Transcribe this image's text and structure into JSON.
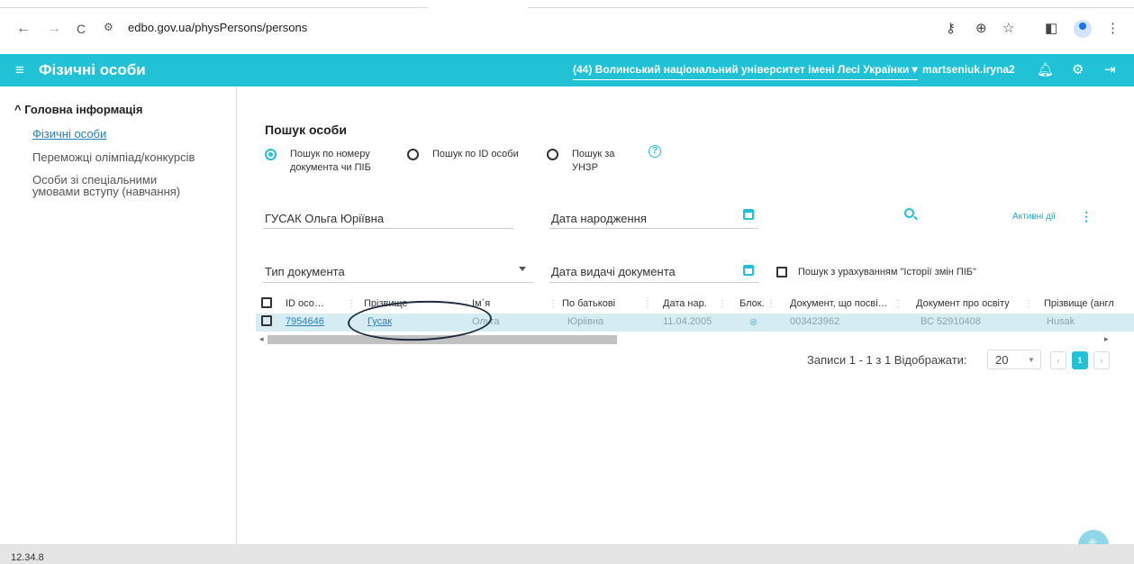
{
  "browser": {
    "back": "←",
    "forward": "→",
    "reload": "C",
    "site_icon": "⚙",
    "url": "edbo.gov.ua/physPersons/persons",
    "icons": [
      "key-icon",
      "zoom-icon",
      "star-icon",
      "sidepanel-icon",
      "profile-icon",
      "kebab-menu-icon"
    ]
  },
  "header": {
    "menu_glyph": "≡",
    "title": "Фізичні особи",
    "university": "(44) Волинський національний університет імені Лесі Українки",
    "username": "martseniuk.iryna2",
    "colors": {
      "accent": "#21c2d6"
    }
  },
  "sidebar": {
    "section": "^ Головна інформація",
    "items": [
      {
        "label": "Фізичні особи"
      },
      {
        "label": "Переможці олімпіад/конкурсів"
      },
      {
        "label": "Особи зі спеціальними"
      },
      {
        "label": "умовами вступу (навчання)"
      }
    ]
  },
  "search": {
    "title": "Пошук особи",
    "radios": [
      {
        "line1": "Пошук по номеру",
        "line2": "документа чи ПІБ",
        "checked": true
      },
      {
        "line1": "Пошук по ID особи",
        "line2": "",
        "checked": false
      },
      {
        "line1": "Пошук за",
        "line2": "УНЗР",
        "checked": false
      }
    ],
    "help": "?",
    "name_value": "ГУСАК Ольга Юріївна",
    "birth_date_label": "Дата народження",
    "active_actions": "Активні дії",
    "kebab": "⋮",
    "doc_type_label": "Тип документа",
    "issue_date_label": "Дата видачі документа",
    "history_label": "Пошук з урахуванням \"Історії змін ПІБ\""
  },
  "table": {
    "headers": [
      "ID осо…",
      "Прізвище",
      "Ім`я",
      "По батькові",
      "Дата нар.",
      "Блок.",
      "Документ, що посві…",
      "Документ про освіту",
      "Прізвище (англ"
    ],
    "row": {
      "id": "7954646",
      "surname": "Гусак",
      "name": "Ольга",
      "patronymic": "Юріівна",
      "birth_date": "11.04.2005",
      "blocked": "⊗",
      "id_doc": "003423962",
      "edu_doc": "ВС 52910408",
      "surname_en": "Husak"
    }
  },
  "pager": {
    "info": "Записи 1 - 1 з 1 Відображати:",
    "page_size": "20",
    "prev": "‹",
    "current": "1",
    "next": "›"
  },
  "footer": {
    "version": "12.34.8"
  }
}
